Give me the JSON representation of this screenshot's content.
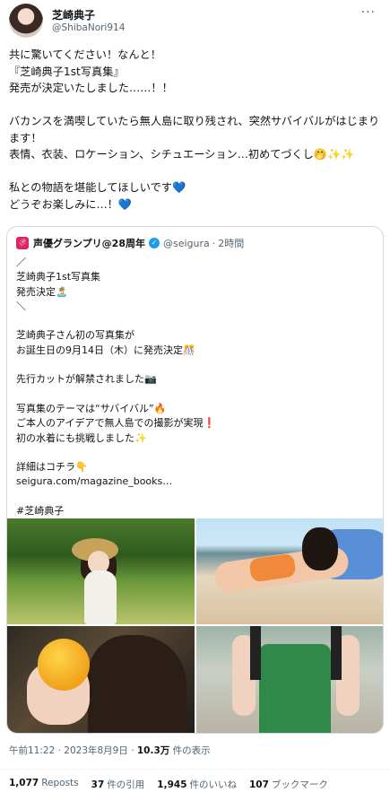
{
  "author": {
    "name": "芝崎典子",
    "handle": "@ShibaNori914",
    "more_label": "···"
  },
  "tweet": {
    "text": "共に驚いてください！なんと！\n『芝崎典子1st写真集』\n発売が決定いたしました……！！\n\nバカンスを満喫していたら無人島に取り残され、突然サバイバルがはじまります！\n表情、衣装、ロケーション、シチュエーション…初めてづくし🤭✨✨\n\n私との物語を堪能してほしいです💙\nどうぞお楽しみに…！💙"
  },
  "quote": {
    "logo": "🦑",
    "name": "声優グランプリ@28周年",
    "verified": "✓",
    "handle": "@seigura",
    "separator": "·",
    "time": "2時間",
    "text": "／\n芝崎典子1st写真集\n発売決定🏝️\n＼\n\n芝崎典子さん初の写真集が\nお誕生日の9月14日（木）に発売決定🎊\n\n先行カットが解禁されました📷\n\n写真集のテーマは“サバイバル”🔥\nご本人のアイデアで無人島での撮影が実現❗\n初の水着にも挑戦しました✨\n\n詳細はコチラ👇\nseigura.com/magazine_books…\n\n#芝崎典子"
  },
  "meta": {
    "datetime": "午前11:22 · 2023年8月9日 · ",
    "views_count": "10.3万",
    "views_label": " 件の表示"
  },
  "stats": {
    "reposts_count": "1,077",
    "reposts_label": "Reposts",
    "quotes_count": "37",
    "quotes_label": "件の引用",
    "likes_count": "1,945",
    "likes_label": "件のいいね",
    "bookmarks_count": "107",
    "bookmarks_label": "ブックマーク"
  }
}
